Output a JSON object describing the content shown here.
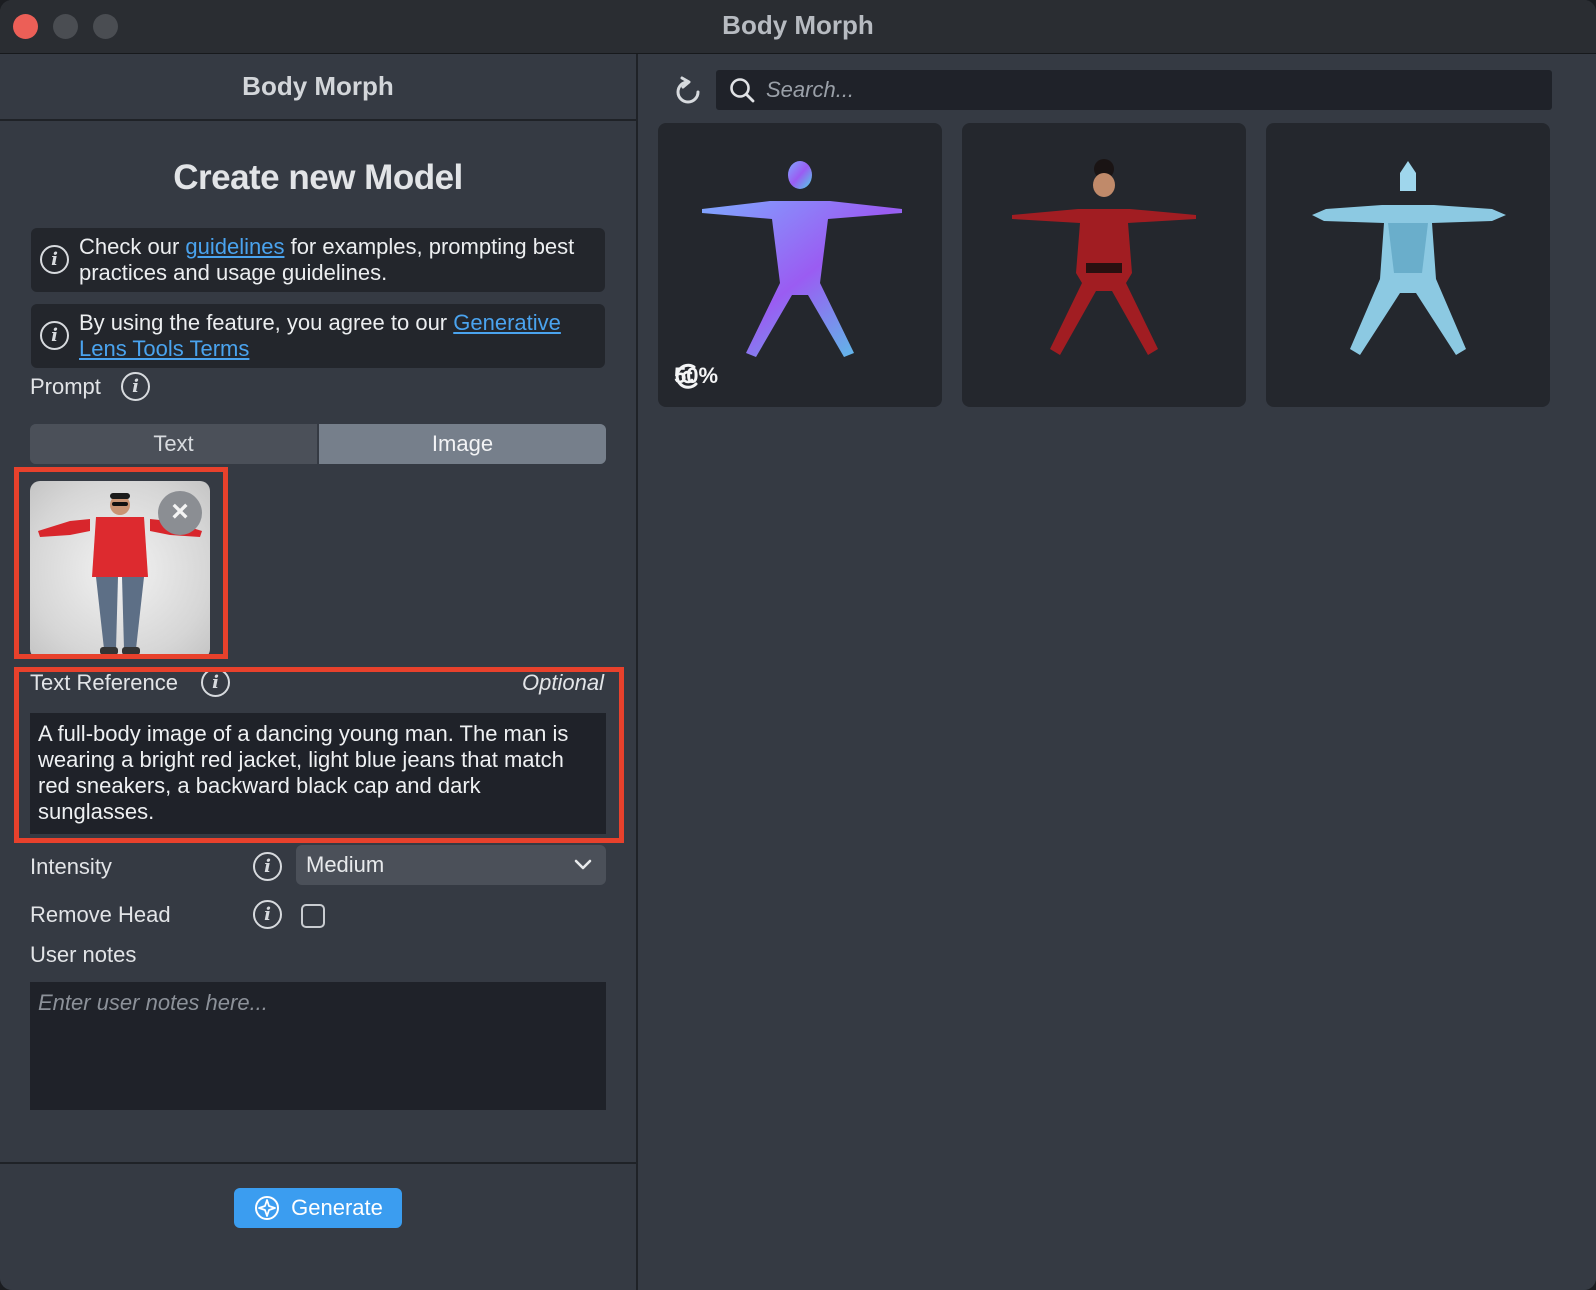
{
  "window": {
    "title": "Body Morph"
  },
  "panel": {
    "header": "Body Morph",
    "create_title": "Create new Model",
    "info1": {
      "before": "Check our ",
      "link": "guidelines",
      "after": " for examples, prompting best practices and usage guidelines."
    },
    "info2": {
      "before": "By using the feature, you agree to our ",
      "link": "Generative Lens Tools Terms"
    },
    "prompt_label": "Prompt",
    "tabs": {
      "text": "Text",
      "image": "Image",
      "selected": "Image"
    },
    "text_reference": {
      "label": "Text Reference",
      "optional": "Optional",
      "value": "A full-body image of a dancing young man. The man is wearing a bright red jacket, light blue jeans that match red sneakers, a backward black cap and dark sunglasses."
    },
    "intensity": {
      "label": "Intensity",
      "value": "Medium"
    },
    "remove_head": {
      "label": "Remove Head",
      "checked": false
    },
    "user_notes": {
      "label": "User notes",
      "placeholder": "Enter user notes here..."
    },
    "generate_label": "Generate"
  },
  "gallery": {
    "search_placeholder": "Search...",
    "cards": [
      {
        "style": "normal-map",
        "progress": "50%"
      },
      {
        "style": "red-outfit"
      },
      {
        "style": "ice-armor"
      }
    ]
  },
  "colors": {
    "accent": "#3b9df0",
    "link": "#4aa3ee",
    "highlight": "#e8412c",
    "close": "#ec5f57"
  }
}
